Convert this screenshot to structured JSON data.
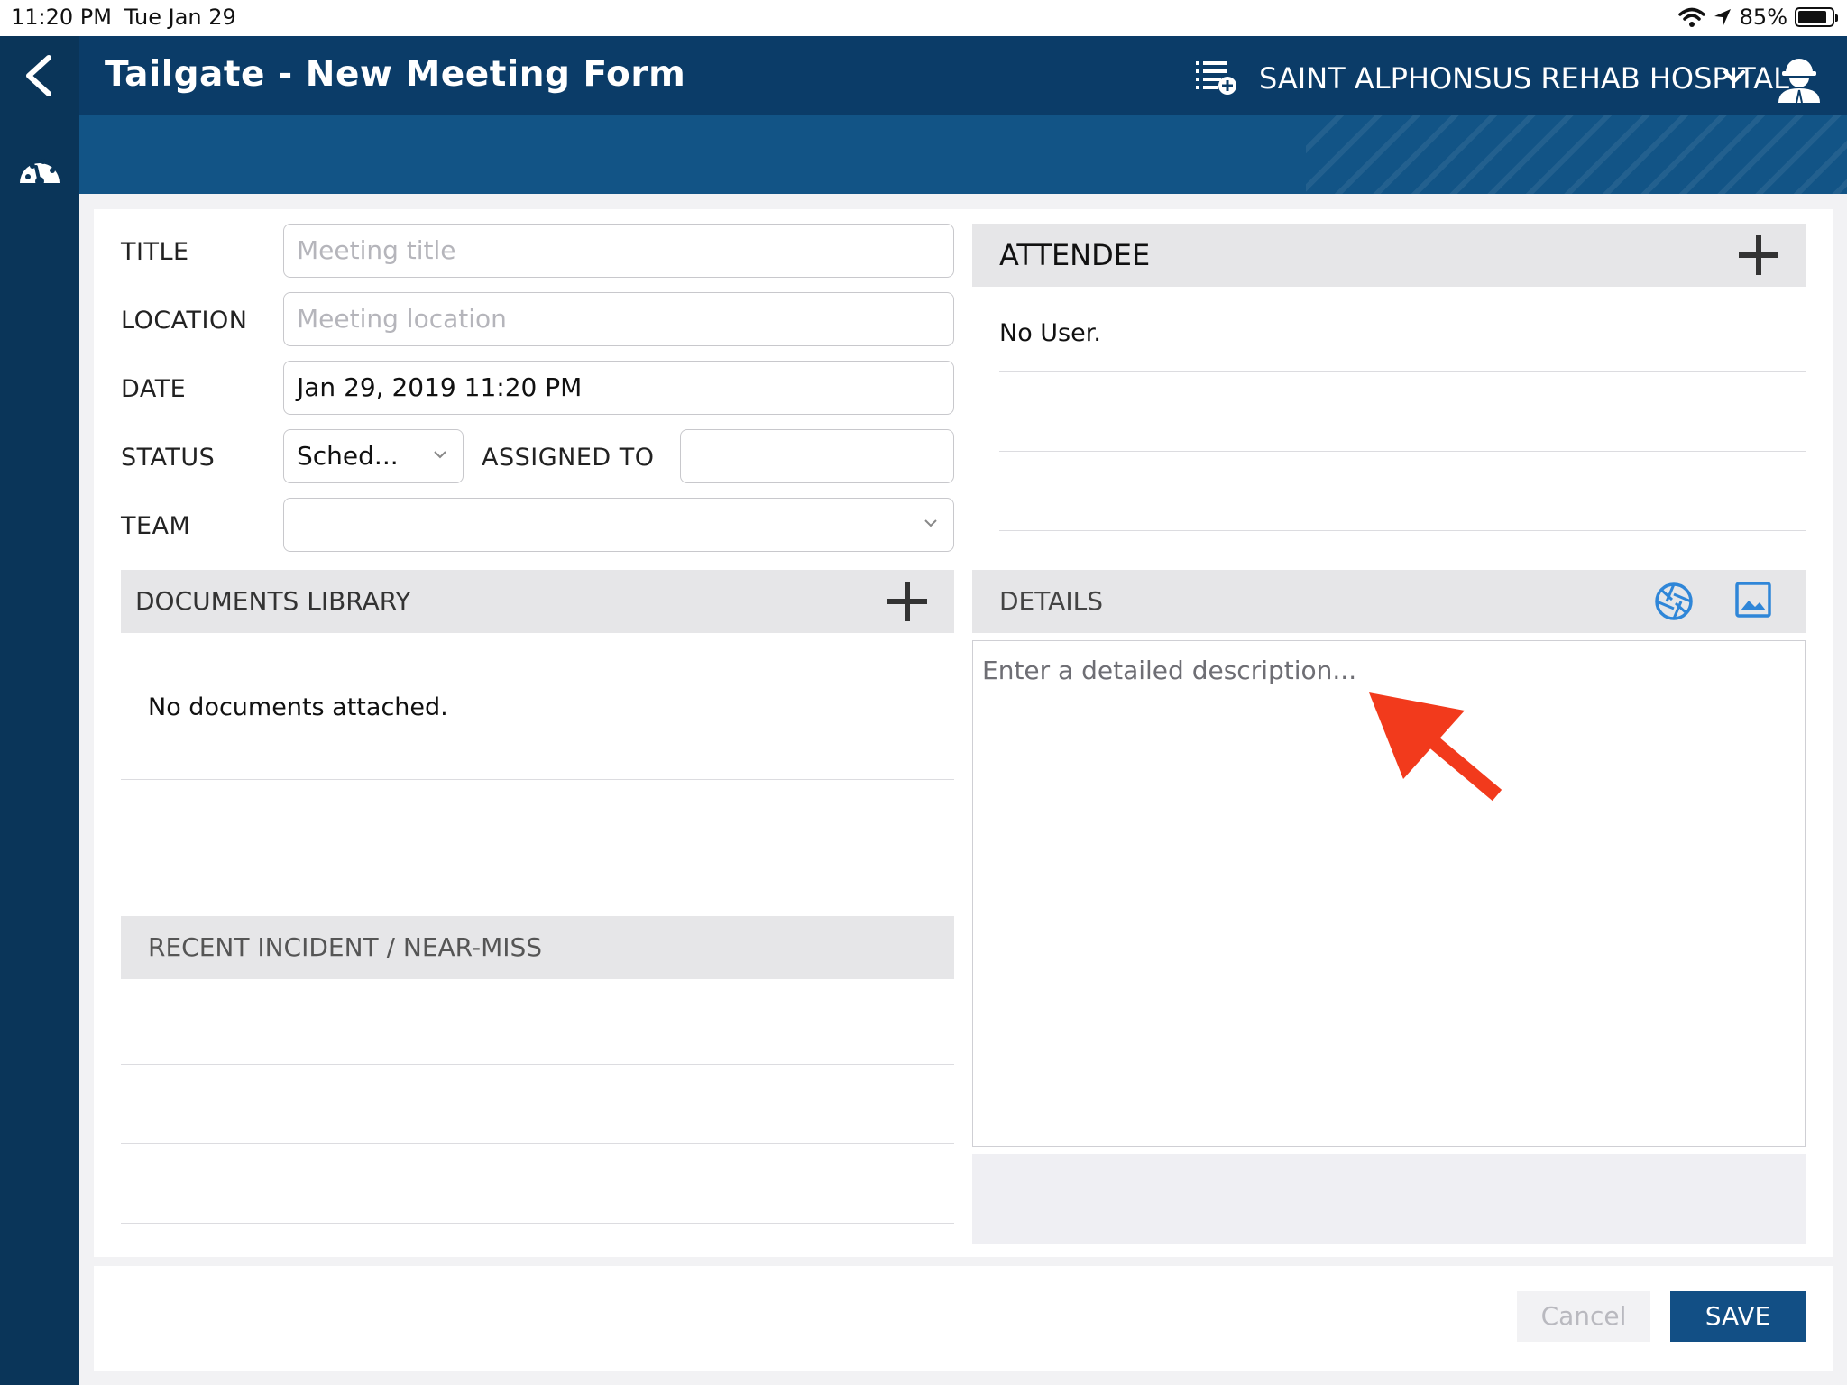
{
  "status_bar": {
    "time": "11:20 PM",
    "date": "Tue Jan 29",
    "battery": "85%",
    "battery_level": 0.85
  },
  "header": {
    "title": "Tailgate - New Meeting Form",
    "organization": "SAINT ALPHONSUS REHAB HOSPITAL",
    "icons": [
      "back-chevron-icon",
      "dashboard-gauge-icon",
      "list-add-icon",
      "chevron-down-icon",
      "worker-hardhat-icon"
    ]
  },
  "form": {
    "title": {
      "label": "TITLE",
      "value": "",
      "placeholder": "Meeting title"
    },
    "location": {
      "label": "LOCATION",
      "value": "",
      "placeholder": "Meeting location"
    },
    "date": {
      "label": "DATE",
      "value": "Jan 29, 2019 11:20 PM"
    },
    "status": {
      "label": "STATUS",
      "value": "Sched..."
    },
    "assigned_to": {
      "label": "ASSIGNED TO",
      "value": ""
    },
    "team": {
      "label": "TEAM",
      "value": ""
    }
  },
  "attendee": {
    "heading": "ATTENDEE",
    "empty_text": "No User."
  },
  "documents": {
    "heading": "DOCUMENTS LIBRARY",
    "empty_text": "No documents attached."
  },
  "incidents": {
    "heading": "RECENT INCIDENT / NEAR-MISS"
  },
  "details": {
    "heading": "DETAILS",
    "placeholder": "Enter a detailed description..."
  },
  "footer": {
    "cancel_label": "Cancel",
    "save_label": "SAVE"
  },
  "colors": {
    "header_bg": "#0b3c68",
    "subbar_bg": "#125486",
    "rail_bg": "#0a3559",
    "save_bg": "#124f85",
    "accent_icon": "#2f86d8",
    "annotation_arrow": "#f23a1c"
  }
}
